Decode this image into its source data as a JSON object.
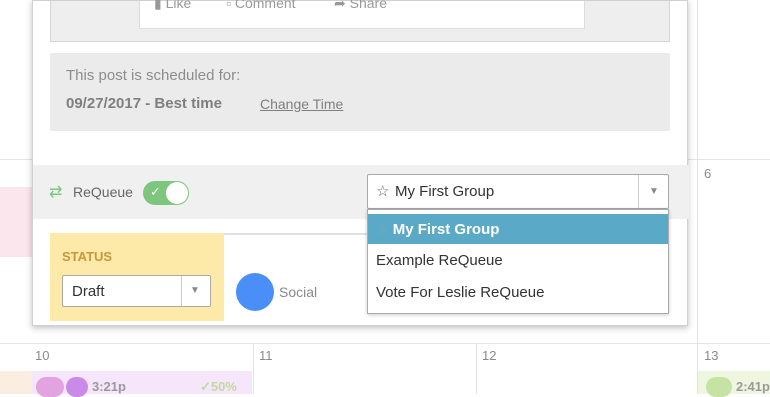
{
  "calendar": {
    "day_6": "6",
    "day_10": "10",
    "day_11": "11",
    "day_12": "12",
    "day_13": "13",
    "event_time_1": "3:21p",
    "event_pct_1": "✓50%",
    "event_time_2": "2:41p"
  },
  "preview": {
    "like_label": "Like",
    "comment_label": "Comment",
    "share_label": "Share"
  },
  "schedule": {
    "heading": "This post is scheduled for:",
    "date": "09/27/2017 - Best time",
    "change_link": "Change Time"
  },
  "requeue": {
    "label": "ReQueue",
    "enabled": true,
    "selected_group": "My First Group",
    "options": [
      "My First Group",
      "Example ReQueue",
      "Vote For Leslie ReQueue"
    ]
  },
  "status": {
    "heading": "STATUS",
    "value": "Draft"
  },
  "social": {
    "label": "Social",
    "avatar_color": "#4a8ff7"
  },
  "colors": {
    "toggle_on": "#7cc67d",
    "dropdown_highlight": "#5aa9c6",
    "status_bg": "#fde9a8"
  }
}
